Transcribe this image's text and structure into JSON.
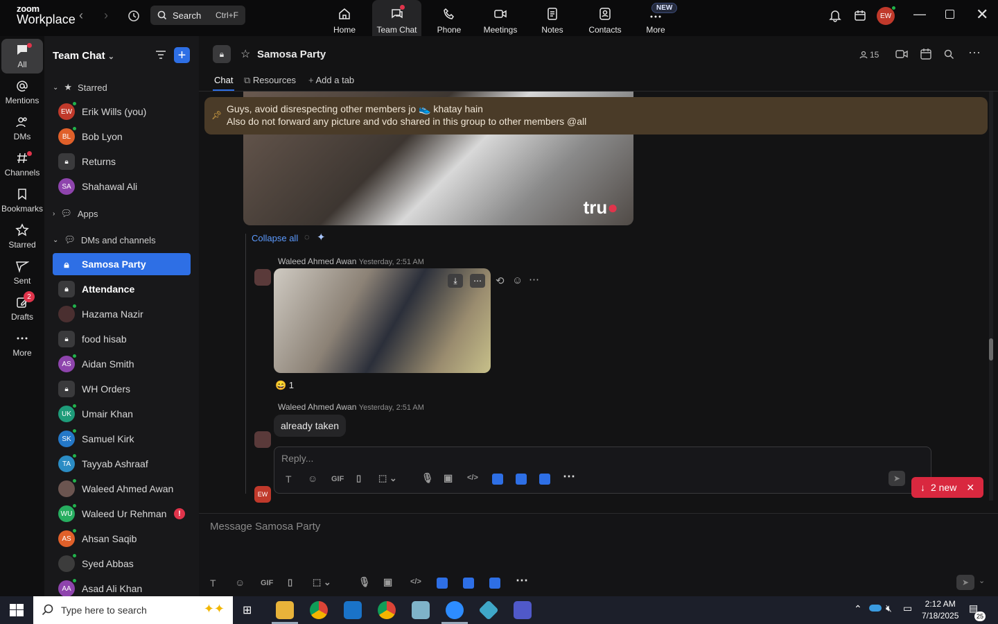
{
  "app": {
    "brand_top": "zoom",
    "brand_bottom": "Workplace"
  },
  "search": {
    "label": "Search",
    "shortcut": "Ctrl+F"
  },
  "topnav": [
    {
      "label": "Home"
    },
    {
      "label": "Team Chat"
    },
    {
      "label": "Phone"
    },
    {
      "label": "Meetings"
    },
    {
      "label": "Notes"
    },
    {
      "label": "Contacts"
    },
    {
      "label": "More"
    }
  ],
  "more_badge": "NEW",
  "user_avatar": "EW",
  "rail": [
    {
      "label": "All"
    },
    {
      "label": "Mentions"
    },
    {
      "label": "DMs"
    },
    {
      "label": "Channels"
    },
    {
      "label": "Bookmarks"
    },
    {
      "label": "Starred"
    },
    {
      "label": "Sent"
    },
    {
      "label": "Drafts"
    },
    {
      "label": "More"
    }
  ],
  "drafts_count": "2",
  "sidebar": {
    "title": "Team Chat",
    "sections": {
      "starred": "Starred",
      "apps": "Apps",
      "dms": "DMs and channels"
    },
    "starred": [
      {
        "initials": "EW",
        "name": "Erik Wills (you)",
        "color": "#c0392b"
      },
      {
        "initials": "BL",
        "name": "Bob Lyon",
        "color": "#e0602a"
      },
      {
        "initials": "",
        "name": "Returns",
        "color": "#3a3a3c"
      },
      {
        "initials": "SA",
        "name": "Shahawal Ali",
        "color": "#8e44ad"
      }
    ],
    "items": [
      {
        "initials": "",
        "name": "Samosa Party"
      },
      {
        "initials": "",
        "name": "Attendance"
      },
      {
        "initials": "",
        "name": "Hazama Nazir"
      },
      {
        "initials": "",
        "name": "food hisab"
      },
      {
        "initials": "AS",
        "name": "Aidan Smith"
      },
      {
        "initials": "",
        "name": "WH Orders"
      },
      {
        "initials": "UK",
        "name": "Umair Khan"
      },
      {
        "initials": "SK",
        "name": "Samuel Kirk"
      },
      {
        "initials": "TA",
        "name": "Tayyab Ashraaf"
      },
      {
        "initials": "",
        "name": "Waleed Ahmed Awan"
      },
      {
        "initials": "WU",
        "name": "Waleed Ur Rehman"
      },
      {
        "initials": "AS",
        "name": "Ahsan Saqib"
      },
      {
        "initials": "",
        "name": "Syed Abbas"
      },
      {
        "initials": "AA",
        "name": "Asad Ali Khan"
      }
    ],
    "alert": "!"
  },
  "channel": {
    "title": "Samosa Party",
    "members": "15",
    "tabs": {
      "chat": "Chat",
      "resources": "Resources",
      "add": "Add a tab"
    },
    "pinned_line1": "Guys, avoid disrespecting other members jo 👟 khatay hain",
    "pinned_line2": "Also do not forward any picture and vdo shared in this group to other members @all",
    "image_watermark": "tru",
    "collapse_all": "Collapse all",
    "msg1_name": "Waleed Ahmed Awan",
    "msg1_time": "Yesterday, 2:51 AM",
    "reaction": "😄 1",
    "msg2_name": "Waleed Ahmed Awan",
    "msg2_time": "Yesterday, 2:51 AM",
    "msg2_text": "already taken",
    "reply_placeholder": "Reply...",
    "reply_avatar": "EW",
    "new_messages": "2 new",
    "composer_placeholder": "Message Samosa Party"
  },
  "toolbar": {
    "gif": "GIF",
    "code": "</>",
    "text": "T"
  },
  "taskbar": {
    "search_placeholder": "Type here to search",
    "time": "2:12 AM",
    "date": "7/18/2025",
    "notifications": "25"
  }
}
